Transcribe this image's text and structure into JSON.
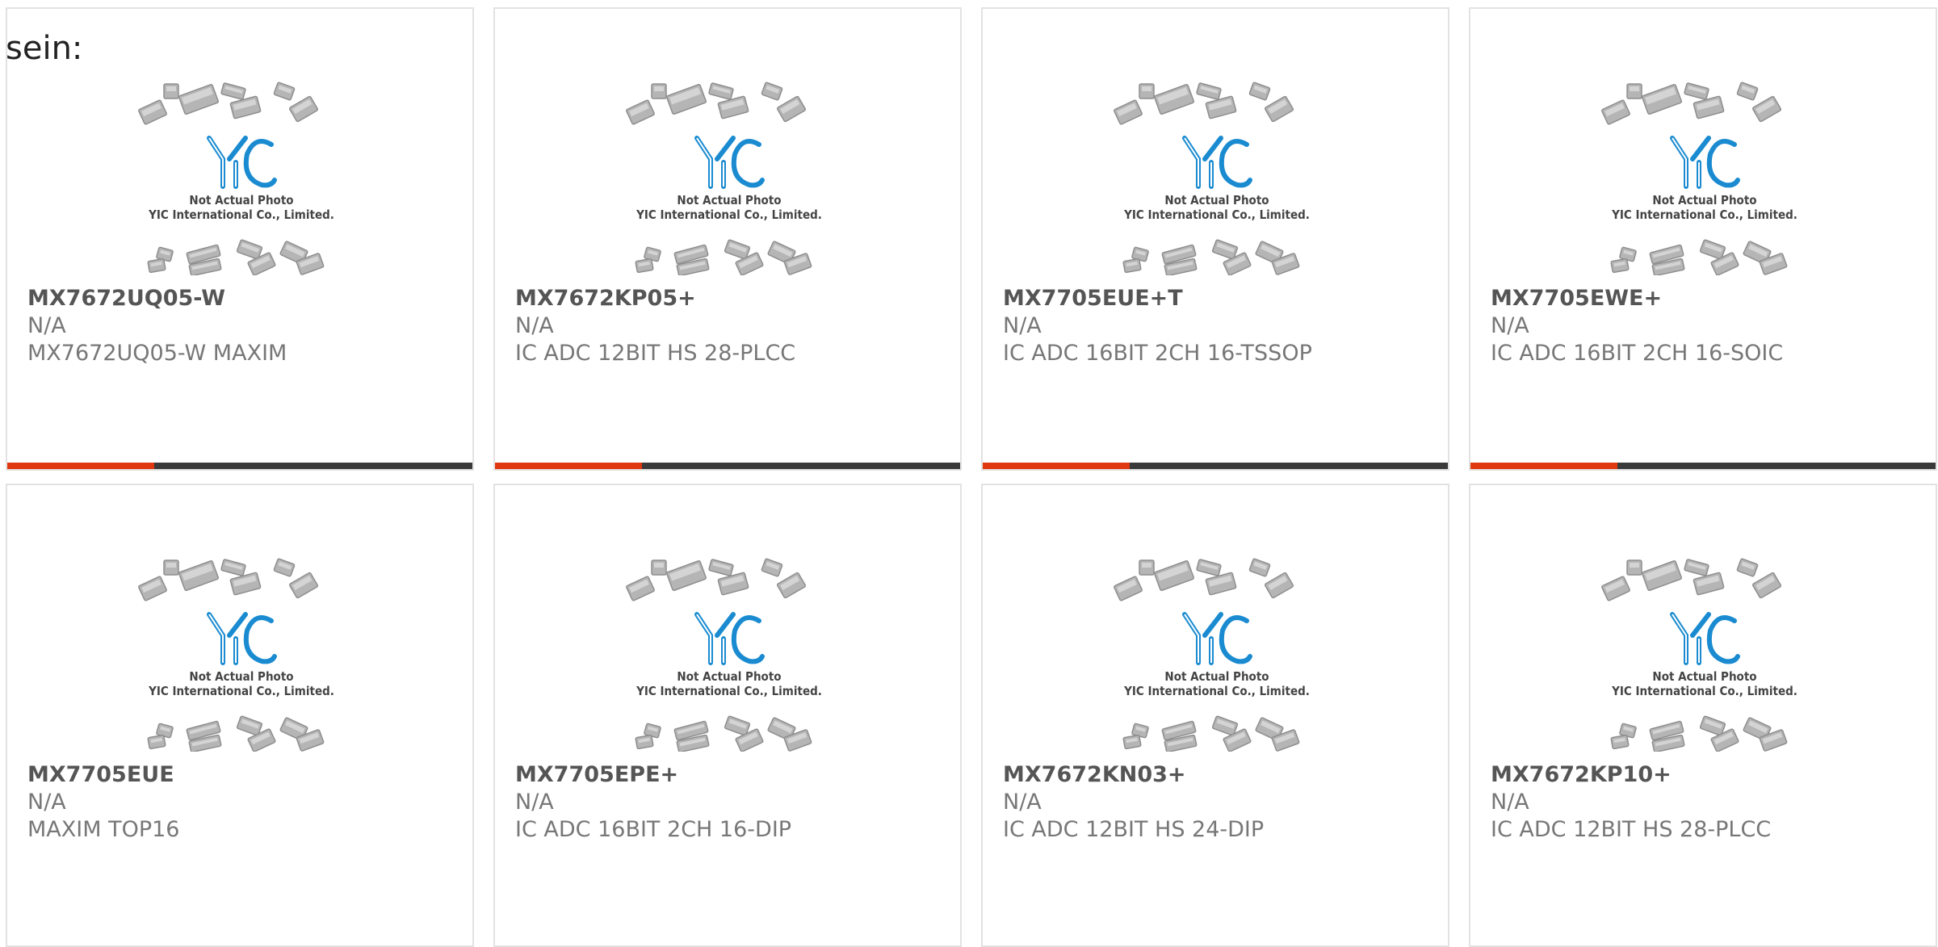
{
  "heading": "sein:",
  "placeholder": {
    "logo": "YIC",
    "line1": "Not Actual Photo",
    "line2": "YIC International Co., Limited."
  },
  "colors": {
    "accent": "#e03810",
    "bar": "#3a3a3a",
    "logo_blue": "#1a8bd0"
  },
  "products": [
    {
      "name": "MX7672UQ05-W",
      "manufacturer": "N/A",
      "description": "MX7672UQ05-W MAXIM"
    },
    {
      "name": "MX7672KP05+",
      "manufacturer": "N/A",
      "description": "IC ADC 12BIT HS 28-PLCC"
    },
    {
      "name": "MX7705EUE+T",
      "manufacturer": "N/A",
      "description": "IC ADC 16BIT 2CH 16-TSSOP"
    },
    {
      "name": "MX7705EWE+",
      "manufacturer": "N/A",
      "description": "IC ADC 16BIT 2CH 16-SOIC"
    },
    {
      "name": "MX7705EUE",
      "manufacturer": "N/A",
      "description": "MAXIM TOP16"
    },
    {
      "name": "MX7705EPE+",
      "manufacturer": "N/A",
      "description": "IC ADC 16BIT 2CH 16-DIP"
    },
    {
      "name": "MX7672KN03+",
      "manufacturer": "N/A",
      "description": "IC ADC 12BIT HS 24-DIP"
    },
    {
      "name": "MX7672KP10+",
      "manufacturer": "N/A",
      "description": "IC ADC 12BIT HS 28-PLCC"
    }
  ]
}
